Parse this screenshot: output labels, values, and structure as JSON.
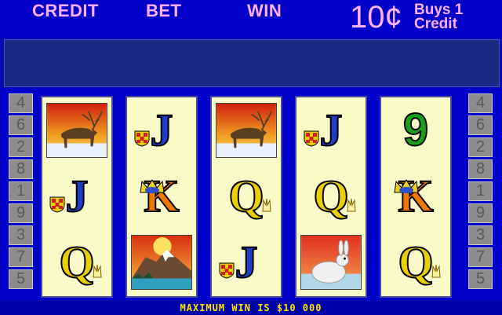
{
  "header": {
    "credit_label": "CREDIT",
    "bet_label": "BET",
    "win_label": "WIN",
    "denomination": "10¢",
    "buys_line1": "Buys 1",
    "buys_line2": "Credit"
  },
  "message_bar": "",
  "paylines_left": [
    "4",
    "6",
    "2",
    "8",
    "1",
    "9",
    "3",
    "7",
    "5"
  ],
  "paylines_right": [
    "4",
    "6",
    "2",
    "8",
    "1",
    "9",
    "3",
    "7",
    "5"
  ],
  "reels": [
    {
      "symbols": [
        "caribou-icon",
        "J",
        "Q"
      ]
    },
    {
      "symbols": [
        "J",
        "K",
        "mountain-icon"
      ]
    },
    {
      "symbols": [
        "caribou-icon",
        "Q",
        "J"
      ]
    },
    {
      "symbols": [
        "J",
        "Q",
        "snow-hare-icon"
      ]
    },
    {
      "symbols": [
        "9",
        "K",
        "Q"
      ]
    }
  ],
  "footer": {
    "max_win": "MAXIMUM WIN IS  $10 000"
  },
  "colors": {
    "background": "#0000c8",
    "header_text": "#ffb0ff",
    "footer_text": "#ffe400",
    "reel_bg": "#fafac8"
  }
}
